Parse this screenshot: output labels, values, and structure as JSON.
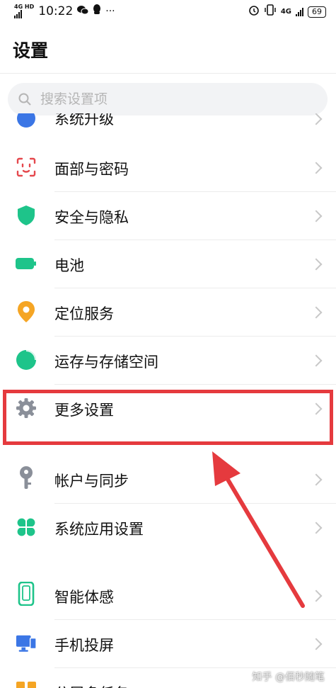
{
  "status_bar": {
    "network_label": "4G HD",
    "time": "10:22",
    "notification_icons": [
      "wechat-icon",
      "qq-icon"
    ],
    "more": "···",
    "right_network": "4G",
    "battery": "69"
  },
  "header": {
    "title": "设置"
  },
  "search": {
    "placeholder": "搜索设置项"
  },
  "items": [
    {
      "label": "系统升级",
      "icon": "system-upgrade-icon",
      "color": "#3b76e5"
    },
    {
      "label": "面部与密码",
      "icon": "face-id-icon",
      "color": "#e5484d"
    },
    {
      "label": "安全与隐私",
      "icon": "shield-icon",
      "color": "#1ec48a"
    },
    {
      "label": "电池",
      "icon": "battery-icon",
      "color": "#1ec48a"
    },
    {
      "label": "定位服务",
      "icon": "location-pin-icon",
      "color": "#f5a524"
    },
    {
      "label": "运存与存储空间",
      "icon": "storage-pie-icon",
      "color": "#1ec48a"
    },
    {
      "label": "更多设置",
      "icon": "gear-icon",
      "color": "#8a8f99"
    },
    {
      "label": "帐户与同步",
      "icon": "key-icon",
      "color": "#8a8f99"
    },
    {
      "label": "系统应用设置",
      "icon": "apps-clover-icon",
      "color": "#1ec48a"
    },
    {
      "label": "智能体感",
      "icon": "phone-motion-icon",
      "color": "#1ec48a"
    },
    {
      "label": "手机投屏",
      "icon": "screen-cast-icon",
      "color": "#3b76e5"
    },
    {
      "label": "分屏多任务",
      "icon": "split-screen-icon",
      "color": "#f5a524"
    }
  ],
  "annotation": {
    "highlight_color": "#e53a3e",
    "target": "更多设置"
  },
  "watermark": "知乎 @佰秒随笔"
}
